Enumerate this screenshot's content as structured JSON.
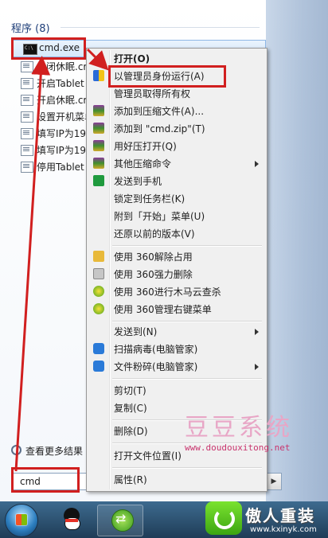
{
  "start_menu": {
    "section_title": "程序 (8)",
    "programs": [
      {
        "label": "cmd.exe"
      },
      {
        "label": "关闭休眠.cmd"
      },
      {
        "label": "开启Tablet"
      },
      {
        "label": "开启休眠.cmd"
      },
      {
        "label": "设置开机菜单"
      },
      {
        "label": "填写IP为19"
      },
      {
        "label": "填写IP为19"
      },
      {
        "label": "停用Tablet"
      }
    ],
    "see_more": "查看更多结果",
    "search_value": "cmd",
    "search_button": "▶"
  },
  "context_menu": {
    "items": [
      {
        "label": "打开(O)",
        "bold": true
      },
      {
        "label": "以管理员身份运行(A)",
        "icon": "uac-shield-icon"
      },
      {
        "label": "管理员取得所有权"
      },
      {
        "label": "添加到压缩文件(A)...",
        "icon": "winrar-icon"
      },
      {
        "label": "添加到 \"cmd.zip\"(T)",
        "icon": "winrar-icon"
      },
      {
        "label": "用好压打开(Q)",
        "icon": "winrar-icon"
      },
      {
        "label": "其他压缩命令",
        "icon": "winrar-icon",
        "submenu": true
      },
      {
        "label": "发送到手机",
        "icon": "phone-icon"
      },
      {
        "label": "锁定到任务栏(K)"
      },
      {
        "label": "附到「开始」菜单(U)"
      },
      {
        "label": "还原以前的版本(V)"
      },
      {
        "label": "使用 360解除占用",
        "icon": "360-unlock-icon"
      },
      {
        "label": "使用 360强力删除",
        "icon": "360-delete-icon"
      },
      {
        "label": "使用 360进行木马云查杀",
        "icon": "360-scan-icon"
      },
      {
        "label": "使用 360管理右键菜单",
        "icon": "360-manage-icon"
      },
      {
        "label": "发送到(N)",
        "submenu": true
      },
      {
        "label": "扫描病毒(电脑管家)",
        "icon": "tencent-shield-icon"
      },
      {
        "label": "文件粉碎(电脑管家)",
        "icon": "tencent-shield-icon",
        "submenu": true
      },
      {
        "label": "剪切(T)"
      },
      {
        "label": "复制(C)"
      },
      {
        "label": "删除(D)"
      },
      {
        "label": "打开文件位置(I)"
      },
      {
        "label": "属性(R)"
      }
    ]
  },
  "watermarks": {
    "site_name": "豆豆系统",
    "site_url": "www.doudouxitong.net",
    "logo_text": "傲人重装",
    "logo_url": "www.kxinyk.com"
  },
  "colors": {
    "highlight": "#d11f1f",
    "selection_border": "#8fb7e6"
  }
}
